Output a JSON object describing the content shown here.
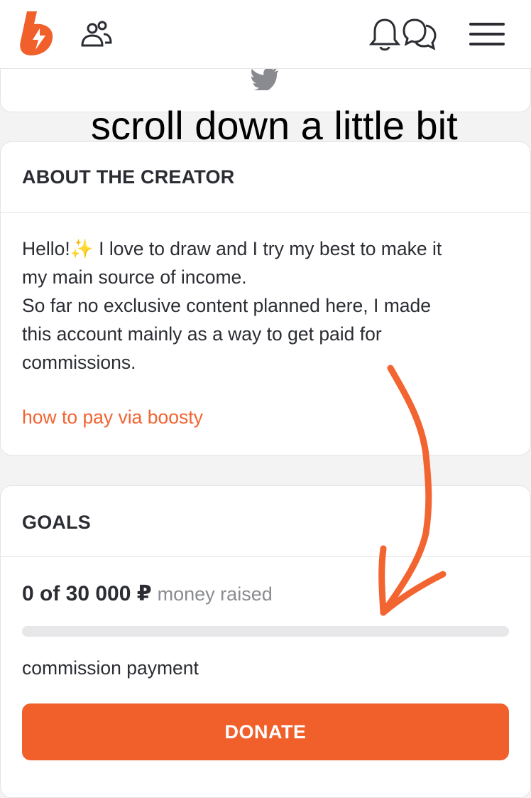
{
  "header": {
    "logo_icon": "boosty-logo",
    "icons": [
      "people-icon",
      "bell-icon",
      "chat-icon",
      "menu-icon"
    ]
  },
  "social_card": {
    "icon": "twitter-icon"
  },
  "annotation": {
    "caption": "scroll down a little bit",
    "arrow_color": "#f26430"
  },
  "about": {
    "title": "ABOUT THE CREATOR",
    "text_line1_before": "Hello!",
    "text_line1_after": " I love to draw and I try my best to make it",
    "text_rest": "my main source of income.\nSo far no exclusive content planned here, I made\nthis account mainly as a way to get paid for\ncommissions.",
    "link": "how to pay via boosty"
  },
  "goals": {
    "title": "GOALS",
    "amount": "0 of 30 000 ₽",
    "amount_suffix": "money raised",
    "progress_fraction": 0,
    "goal_name": "commission payment",
    "donate_label": "DONATE"
  },
  "colors": {
    "accent": "#f15f2b",
    "text": "#2b2d33",
    "muted": "#8a8b90",
    "background": "#f3f3f4"
  }
}
